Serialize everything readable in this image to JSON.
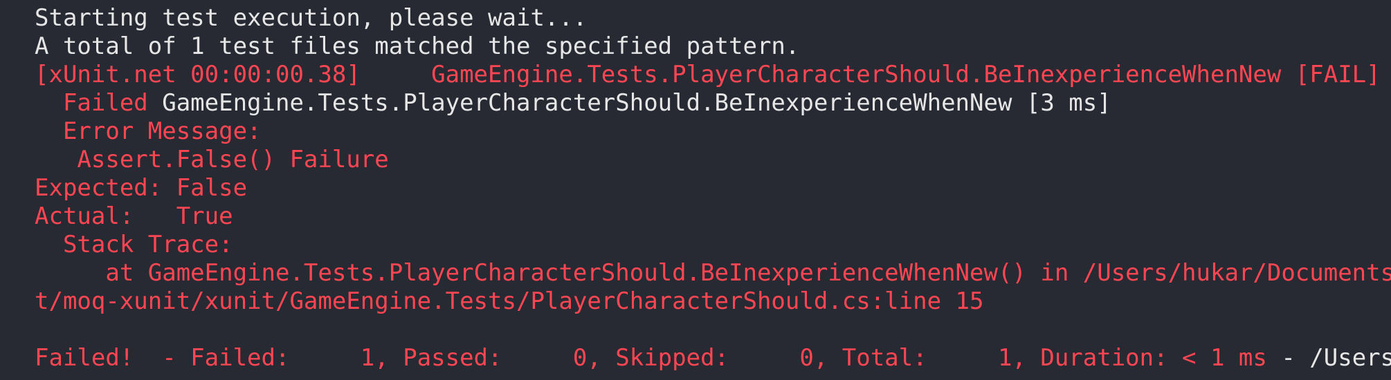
{
  "terminal": {
    "lines": {
      "starting": "Starting test execution, please wait...",
      "matched": "A total of 1 test files matched the specified pattern.",
      "xunit_result": "[xUnit.net 00:00:00.38]     GameEngine.Tests.PlayerCharacterShould.BeInexperienceWhenNew [FAIL]",
      "failed_prefix": "  Failed",
      "failed_detail": " GameEngine.Tests.PlayerCharacterShould.BeInexperienceWhenNew [3 ms]",
      "error_message_header": "  Error Message:",
      "assert_failure": "   Assert.False() Failure",
      "expected": "Expected: False",
      "actual": "Actual:   True",
      "stack_trace_header": "  Stack Trace:",
      "stack_at": "     at GameEngine.Tests.PlayerCharacterShould.BeInexperienceWhenNew() in /Users/hukar/Documents/p",
      "stack_path_cont": "t/moq-xunit/xunit/GameEngine.Tests/PlayerCharacterShould.cs:line 15",
      "summary_prefix": "Failed!  - Failed:     1, Passed:     0, Skipped:     0, Total:     1, Duration: < 1 ms",
      "summary_suffix": " - /Users/h"
    },
    "colors": {
      "background": "#272a33",
      "normal_text": "#e6e6e6",
      "error_text": "#ff4652"
    }
  }
}
